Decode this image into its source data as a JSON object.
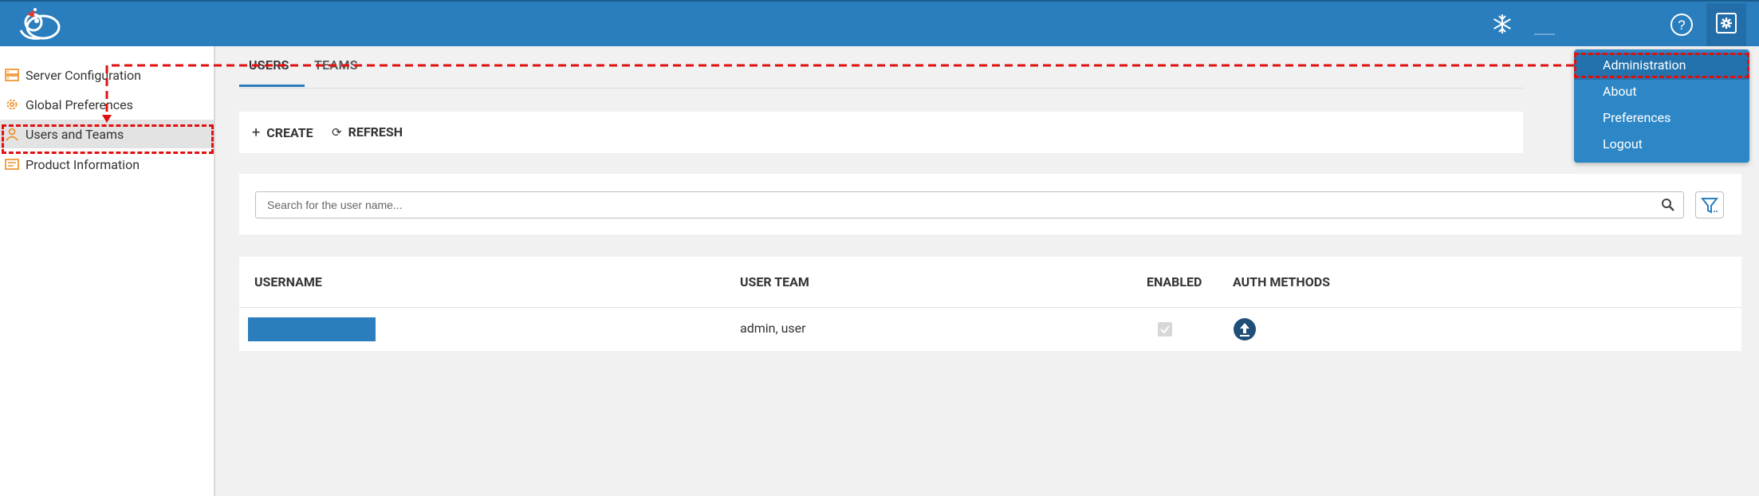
{
  "header": {
    "logo": "app-logo",
    "user_name": "",
    "icons": [
      "snowflake-icon",
      "help-icon",
      "settings-icon"
    ]
  },
  "sidebar": {
    "items": [
      {
        "label": "Server Configuration",
        "icon": "server-icon"
      },
      {
        "label": "Global Preferences",
        "icon": "gear-icon"
      },
      {
        "label": "Users and Teams",
        "icon": "users-icon",
        "active": true
      },
      {
        "label": "Product Information",
        "icon": "info-card-icon"
      }
    ]
  },
  "tabs": [
    {
      "label": "USERS",
      "active": true
    },
    {
      "label": "TEAMS",
      "active": false
    }
  ],
  "toolbar": {
    "create_label": "CREATE",
    "refresh_label": "REFRESH"
  },
  "search": {
    "placeholder": "Search for the user name..."
  },
  "table": {
    "headers": [
      "USERNAME",
      "USER TEAM",
      "ENABLED",
      "AUTH METHODS"
    ],
    "rows": [
      {
        "username": "",
        "user_team": "admin, user",
        "enabled": true,
        "auth_method_icon": "ldap-icon"
      }
    ]
  },
  "dropdown": {
    "items": [
      "Administration",
      "About",
      "Preferences",
      "Logout"
    ],
    "selected": "Administration"
  },
  "colors": {
    "primary": "#2a7ebd",
    "dropdown": "#2d87c7",
    "annotation": "#e01010"
  }
}
